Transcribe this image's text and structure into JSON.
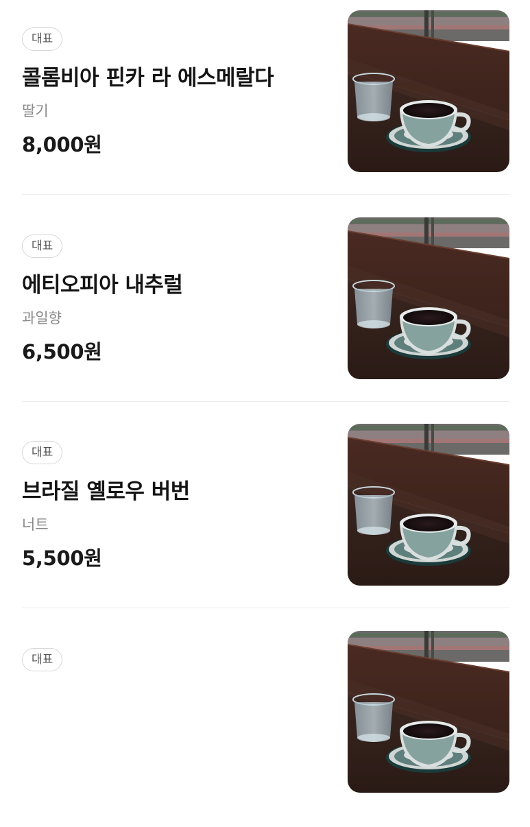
{
  "menu": {
    "items": [
      {
        "badge": "대표",
        "name": "콜롬비아 핀카 라 에스메랄다",
        "description": "딸기",
        "price": "8,000원",
        "image": "coffee-cup-photo"
      },
      {
        "badge": "대표",
        "name": "에티오피아 내추럴",
        "description": "과일향",
        "price": "6,500원",
        "image": "coffee-cup-photo"
      },
      {
        "badge": "대표",
        "name": "브라질 옐로우 버번",
        "description": "너트",
        "price": "5,500원",
        "image": "coffee-cup-photo"
      },
      {
        "badge": "대표",
        "image": "coffee-cup-photo"
      }
    ]
  }
}
